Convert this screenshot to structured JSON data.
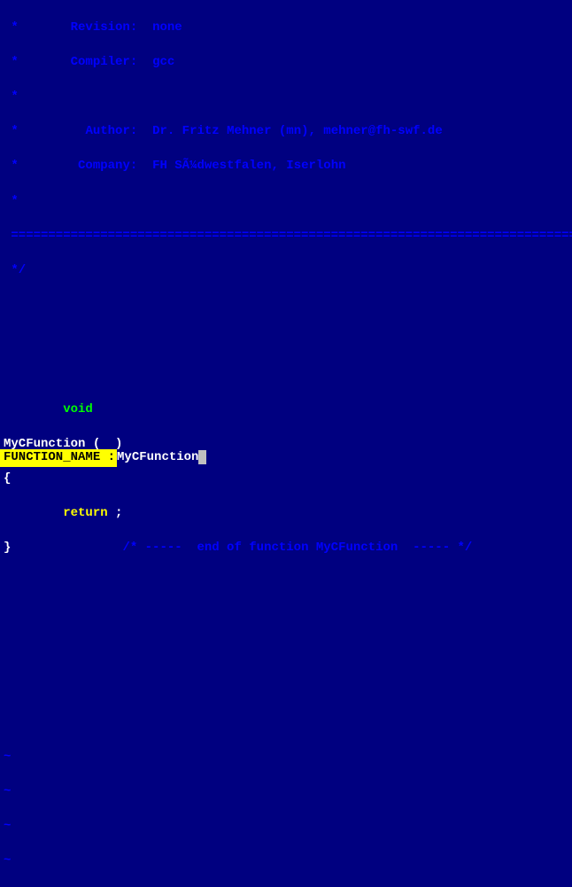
{
  "header": {
    "revision_label": "Revision:",
    "revision_value": "none",
    "compiler_label": "Compiler:",
    "compiler_value": "gcc",
    "author_label": "Author:",
    "author_value": "Dr. Fritz Mehner (mn), mehner@fh-swf.de",
    "company_label": "Company:",
    "company_value": "FH SÃ¼dwestfalen, Iserlohn",
    "separator": " =====================================================================================",
    "end_comment": "*/"
  },
  "code": {
    "return_type": "void",
    "func_decl": "MyCFunction (  )",
    "open_brace": "{",
    "return_stmt": "return ;",
    "close_brace": "}",
    "trailing_comment": "/* -----  end of function MyCFunction  ----- */"
  },
  "tildes": [
    "~",
    "~",
    "~",
    "~"
  ],
  "cmdline": {
    "label": "FUNCTION_NAME : ",
    "value": "MyCFunction"
  },
  "star": " *"
}
